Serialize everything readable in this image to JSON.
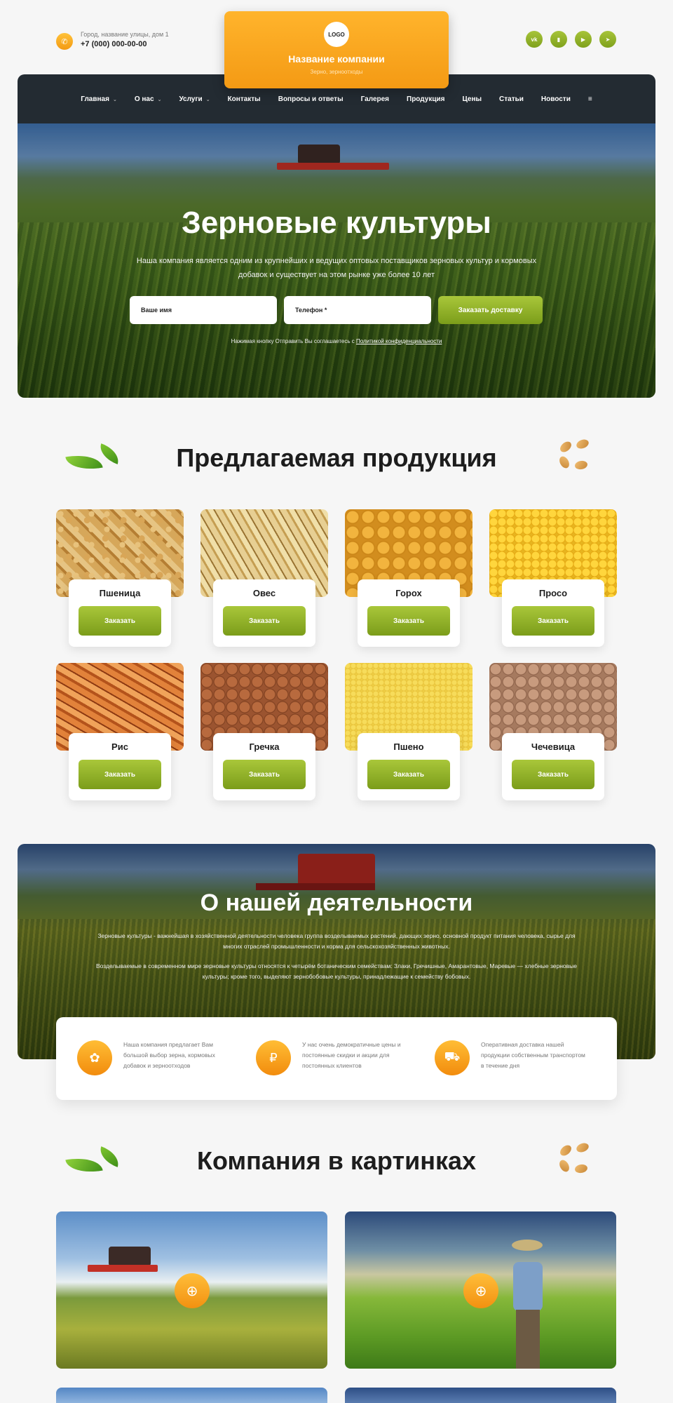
{
  "header": {
    "address": "Город, название улицы, дом 1",
    "phone": "+7 (000) 000-00-00",
    "logo_text": "LOGO",
    "company_name": "Название компании",
    "company_tagline": "Зерно, зерноотходы",
    "socials": [
      "vk-icon",
      "max-icon",
      "youtube-icon",
      "telegram-icon"
    ]
  },
  "nav": {
    "items": [
      {
        "label": "Главная",
        "dropdown": true
      },
      {
        "label": "О нас",
        "dropdown": true
      },
      {
        "label": "Услуги",
        "dropdown": true
      },
      {
        "label": "Контакты",
        "dropdown": false
      },
      {
        "label": "Вопросы и ответы",
        "dropdown": false
      },
      {
        "label": "Галерея",
        "dropdown": false
      },
      {
        "label": "Продукция",
        "dropdown": false
      },
      {
        "label": "Цены",
        "dropdown": false
      },
      {
        "label": "Статьи",
        "dropdown": false
      },
      {
        "label": "Новости",
        "dropdown": false
      }
    ],
    "menu_icon": "≡"
  },
  "hero": {
    "title": "Зерновые культуры",
    "description": "Наша компания является одним из крупнейших и ведущих оптовых поставщиков зерновых культур и кормовых добавок и существует на этом рынке уже более 10 лет",
    "name_placeholder": "Ваше имя",
    "phone_placeholder": "Телефон *",
    "submit_label": "Заказать доставку",
    "agree_text": "Нажимая кнопку Отправить Вы соглашаетесь с",
    "agree_link": "Политикой конфиденциальности"
  },
  "products": {
    "title": "Предлагаемая продукция",
    "order_label": "Заказать",
    "items": [
      {
        "name": "Пшеница"
      },
      {
        "name": "Овес"
      },
      {
        "name": "Горох"
      },
      {
        "name": "Просо"
      },
      {
        "name": "Рис"
      },
      {
        "name": "Гречка"
      },
      {
        "name": "Пшено"
      },
      {
        "name": "Чечевица"
      }
    ]
  },
  "about": {
    "title": "О нашей деятельности",
    "p1": "Зерновые культуры - важнейшая в хозяйственной деятельности человека группа возделываемых растений, дающих зерно, основной продукт питания человека, сырье для многих отраслей промышленности и корма для сельскохозяйственных животных.",
    "p2": "Возделываемые в современном мире зерновые культуры относятся к четырём ботаническим семействам: Злаки, Гречишные, Амарантовые, Маревые — хлебные зерновые культуры; кроме того, выделяют зернобобовые культуры, принадлежащие к семейству бобовых.",
    "features": [
      {
        "icon": "grain-bag-icon",
        "text": "Наша компания предлагает Вам большой выбор зерна, кормовых добавок и зерноотходов"
      },
      {
        "icon": "coins-icon",
        "text": "У нас очень демократичные цены и постоянные скидки и акции для постоянных клиентов"
      },
      {
        "icon": "delivery-truck-icon",
        "text": "Оперативная доставка нашей продукции собственным транспортом в течение дня"
      }
    ]
  },
  "gallery": {
    "title": "Компания в картинках",
    "zoom_icon": "zoom-in-icon"
  },
  "colors": {
    "accent_orange": "#f49a14",
    "accent_green": "#8fb12a",
    "nav_dark": "#232b32"
  }
}
